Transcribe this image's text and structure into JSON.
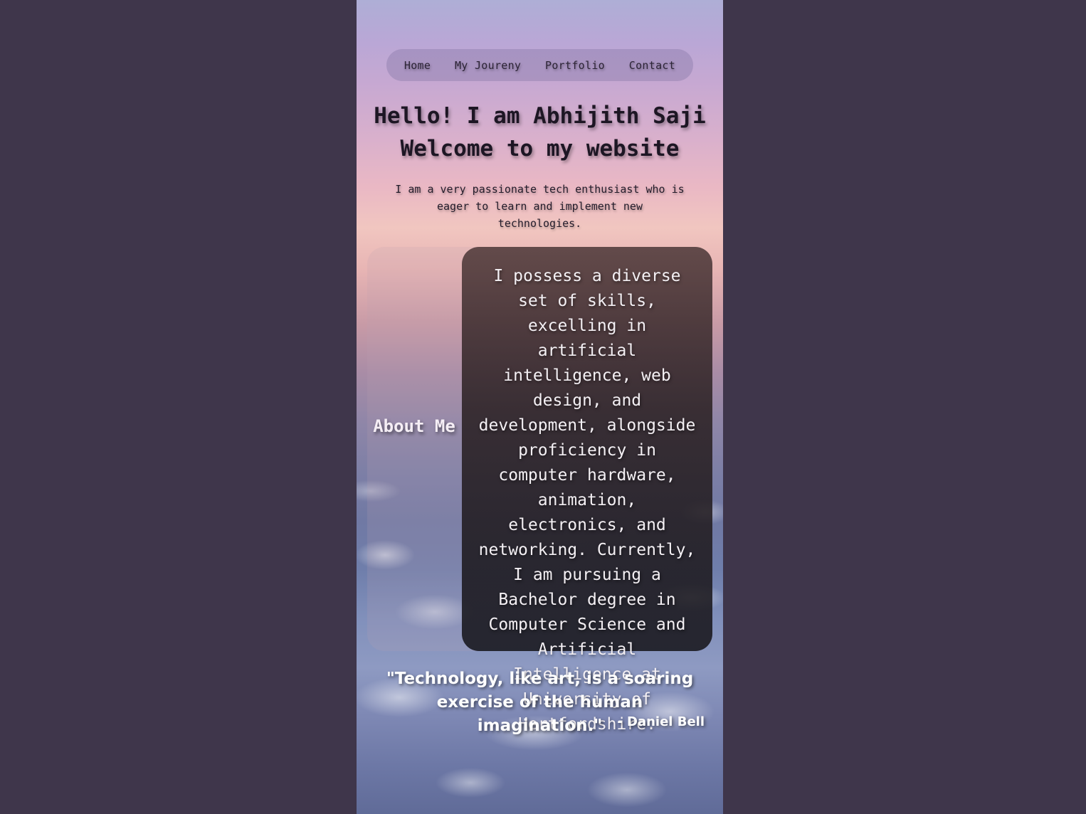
{
  "nav": {
    "items": [
      {
        "label": "Home"
      },
      {
        "label": "My Joureny"
      },
      {
        "label": "Portfolio"
      },
      {
        "label": "Contact"
      }
    ]
  },
  "hero": {
    "title_line1": "Hello! I am Abhijith Saji",
    "title_line2": "Welcome to my website",
    "subtitle": "I am a very passionate tech enthusiast who is eager to learn and implement new technologies."
  },
  "about": {
    "label": "About Me",
    "text": "I possess a diverse set of skills, excelling in artificial intelligence, web design, and development, alongside proficiency in computer hardware, animation, electronics, and networking. Currently, I am pursuing a Bachelor degree in Computer Science and Artificial Intelligence at University of Hertfordshire."
  },
  "quote": {
    "text": "\"Technology, like art, is a soaring exercise of the human imagination.\"",
    "author": "- Daniel Bell"
  },
  "colors": {
    "page_background": "#3f364b",
    "about_panel": "#2a2226",
    "text_light": "#f4f0f4",
    "text_dark": "#1d1624"
  }
}
